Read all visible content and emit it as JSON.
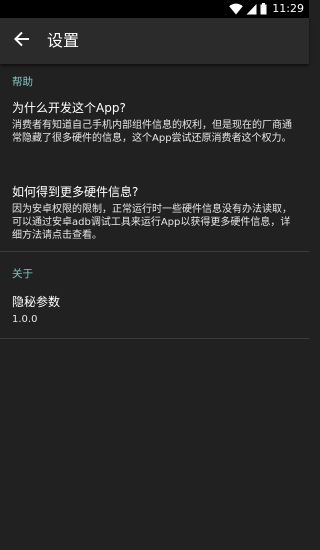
{
  "status_bar": {
    "time": "11:29",
    "icons": [
      "wifi-icon",
      "signal-icon",
      "battery-icon"
    ]
  },
  "toolbar": {
    "title": "设置",
    "back_icon": "arrow-back-icon"
  },
  "sections": [
    {
      "category": "帮助",
      "items": [
        {
          "title": "为什么开发这个App?",
          "summary": "消费者有知道自己手机内部组件信息的权利，但是现在的厂商通常隐藏了很多硬件的信息，这个App尝试还原消费者这个权力。"
        },
        {
          "title": "如何得到更多硬件信息?",
          "summary": "因为安卓权限的限制，正常运行时一些硬件信息没有办法读取，可以通过安卓adb调试工具来运行App以获得更多硬件信息，详细方法请点击查看。"
        }
      ]
    },
    {
      "category": "关于",
      "items": [
        {
          "title": "隐秘参数",
          "summary": "1.0.0"
        }
      ]
    }
  ],
  "colors": {
    "background": "#212121",
    "toolbar": "#2b2b2b",
    "status_bar": "#000000",
    "accent": "#7fc4be",
    "divider": "#3c3c3c"
  }
}
